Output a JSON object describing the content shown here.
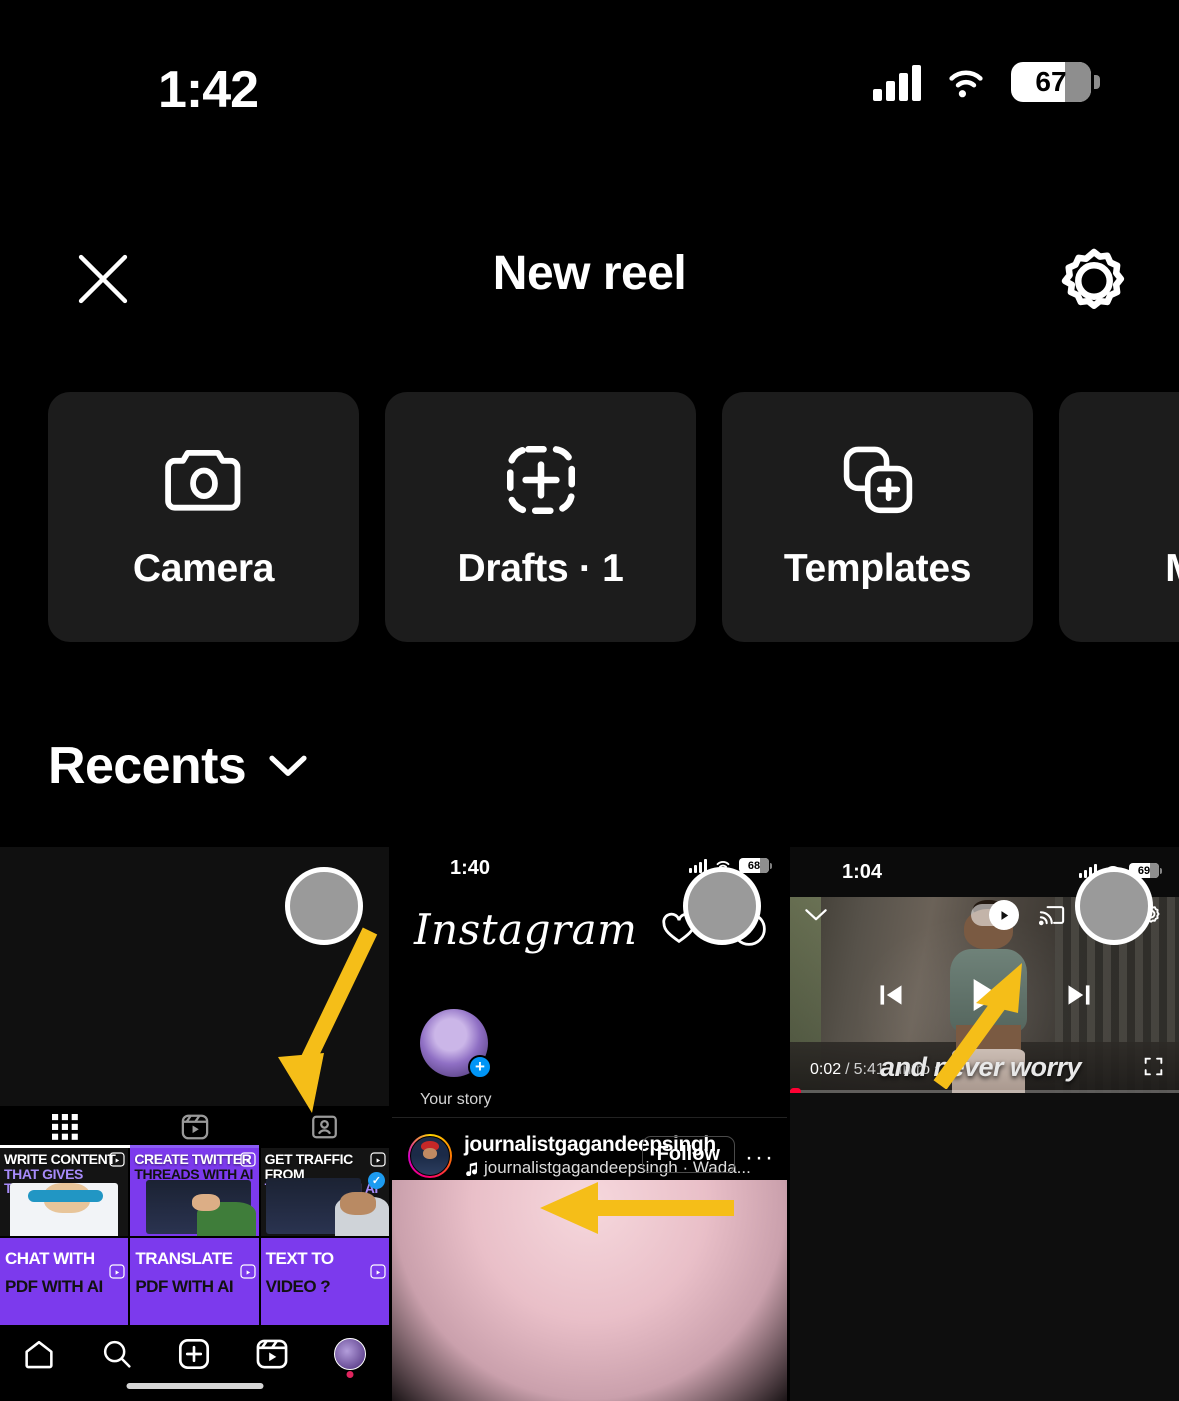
{
  "status_bar": {
    "time": "1:42",
    "battery": "67",
    "icons": [
      "cellular-signal-icon",
      "wifi-icon",
      "battery-icon"
    ]
  },
  "header": {
    "title": "New reel",
    "close_label": "Close",
    "settings_label": "Settings"
  },
  "options": [
    {
      "label": "Camera",
      "icon": "camera-icon"
    },
    {
      "label": "Drafts · 1",
      "icon": "dashed-square-plus-icon"
    },
    {
      "label": "Templates",
      "icon": "stacked-squares-plus-icon"
    },
    {
      "label": "Made",
      "icon": "partial-card-icon"
    }
  ],
  "gallery": {
    "section_label": "Recents",
    "chevron": "chevron-down-icon",
    "items": [
      {
        "name": "instagram-profile-grid-screenshot",
        "selected": false,
        "tabs": [
          "grid-tab-icon",
          "reels-tab-icon",
          "tagged-tab-icon"
        ],
        "posts": [
          {
            "line1": "WRITE CONTENT",
            "line2": "THAT GIVES TRAFFIC"
          },
          {
            "line1": "CREATE TWITTER",
            "line2": "THREADS WITH AI"
          },
          {
            "line1": "GET TRAFFIC FROM",
            "line2": "TWITTER WITH AI"
          },
          {
            "line1": "CHAT WITH",
            "line2": "PDF WITH AI"
          },
          {
            "line1": "TRANSLATE",
            "line2": "PDF WITH AI"
          },
          {
            "line1": "TEXT TO",
            "line2": "VIDEO ?"
          }
        ],
        "nav_icons": [
          "home-icon",
          "search-icon",
          "create-icon",
          "reels-icon",
          "profile-avatar"
        ]
      },
      {
        "name": "instagram-feed-screenshot",
        "selected": false,
        "status_time": "1:40",
        "status_battery": "68",
        "app_logo": "Instagram",
        "actions": [
          "heart-icon",
          "messenger-icon"
        ],
        "story_label": "Your story",
        "story_add": "+",
        "post": {
          "username": "journalistgagandeepsingh",
          "audio": "journalistgagandeepsingh · Wada...",
          "follow_label": "Follow",
          "more": "···"
        }
      },
      {
        "name": "youtube-player-screenshot",
        "selected": false,
        "status_time": "1:04",
        "status_battery": "69",
        "controls": [
          "collapse-chevron-icon",
          "autoplay-toggle",
          "cast-icon",
          "closed-captions-icon",
          "settings-gear-icon"
        ],
        "transport": [
          "previous-icon",
          "play-icon",
          "next-icon"
        ],
        "current_time": "0:02",
        "duration": "5:41",
        "chapter": "Intro",
        "caption_text": "and never worry",
        "fullscreen": "fullscreen-icon"
      }
    ]
  },
  "annotations": {
    "arrow_color": "#F5BE18",
    "arrows": [
      "arrow-pointing-to-create-button",
      "arrow-pointing-to-your-story",
      "arrow-pointing-to-autoplay-toggle"
    ]
  }
}
